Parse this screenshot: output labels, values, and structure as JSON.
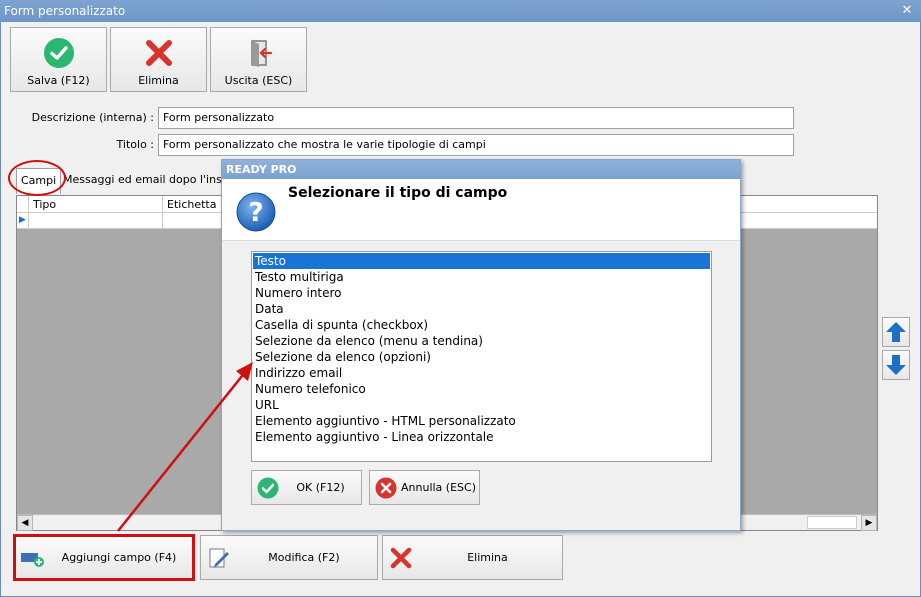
{
  "window": {
    "title": "Form personalizzato",
    "close_glyph": "✕"
  },
  "toolbar": {
    "save_label": "Salva (F12)",
    "delete_label": "Elimina",
    "exit_label": "Uscita (ESC)"
  },
  "form": {
    "description_label": "Descrizione (interna) :",
    "description_value": "Form personalizzato",
    "title_label": "Titolo :",
    "title_value": "Form personalizzato che mostra le varie tipologie di campi"
  },
  "tabs": [
    {
      "label": "Campi"
    },
    {
      "label": "Messaggi ed email dopo l'inserime"
    }
  ],
  "grid": {
    "columns": [
      "Tipo",
      "Etichetta"
    ],
    "row_indicator": "▶"
  },
  "side_buttons": {
    "up_icon": "arrow-up-icon",
    "down_icon": "arrow-down-icon"
  },
  "bottom": {
    "add_label": "Aggiungi campo (F4)",
    "edit_label": "Modifica (F2)",
    "delete_label": "Elimina"
  },
  "dialog": {
    "title": "READY PRO",
    "heading": "Selezionare il tipo di campo",
    "options": [
      "Testo",
      "Testo multiriga",
      "Numero intero",
      "Data",
      "Casella di spunta (checkbox)",
      "Selezione da elenco (menu a tendina)",
      "Selezione da elenco (opzioni)",
      "Indirizzo email",
      "Numero telefonico",
      "URL",
      "Elemento aggiuntivo - HTML personalizzato",
      "Elemento aggiuntivo - Linea orizzontale"
    ],
    "selected_index": 0,
    "ok_label": "OK (F12)",
    "cancel_label": "Annulla (ESC)"
  },
  "colors": {
    "highlight_red": "#d01010",
    "selection_blue": "#1874d5",
    "accent_green": "#2bb673",
    "accent_red": "#d6342c"
  }
}
